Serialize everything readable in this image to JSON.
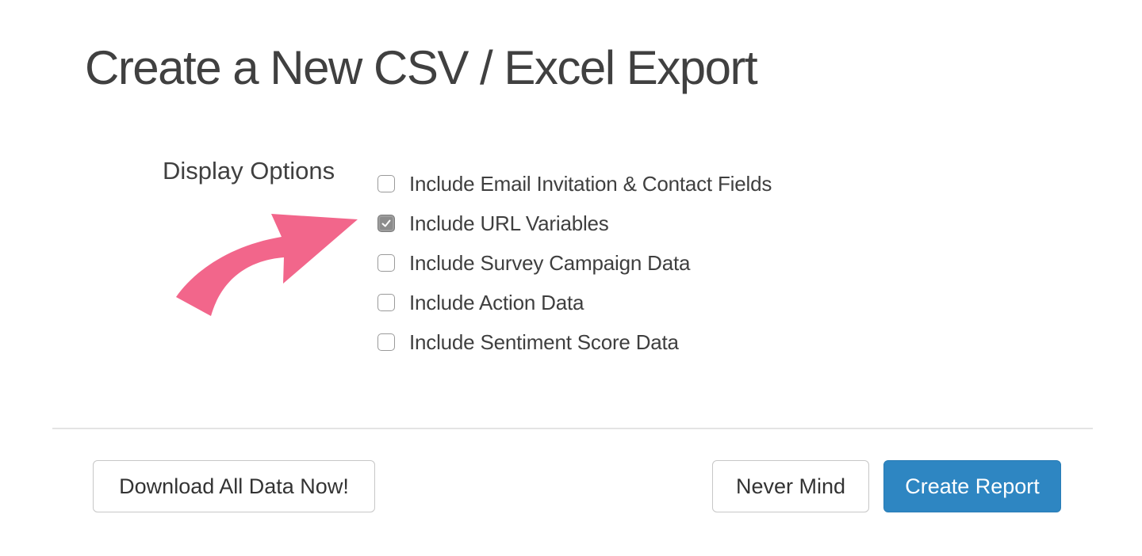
{
  "page": {
    "title": "Create a New CSV / Excel Export"
  },
  "display_options": {
    "label": "Display Options",
    "items": [
      {
        "label": "Include Email Invitation & Contact Fields",
        "checked": false
      },
      {
        "label": "Include URL Variables",
        "checked": true
      },
      {
        "label": "Include Survey Campaign Data",
        "checked": false
      },
      {
        "label": "Include Action Data",
        "checked": false
      },
      {
        "label": "Include Sentiment Score Data",
        "checked": false
      }
    ]
  },
  "annotation": {
    "arrow_color": "#f2668b",
    "arrow_icon": "curved-arrow-icon"
  },
  "footer": {
    "download_label": "Download All Data Now!",
    "never_mind_label": "Never Mind",
    "create_label": "Create Report"
  },
  "colors": {
    "primary_button": "#2e86c2",
    "title_text": "#404040",
    "checked_box": "#8c8c8c"
  }
}
